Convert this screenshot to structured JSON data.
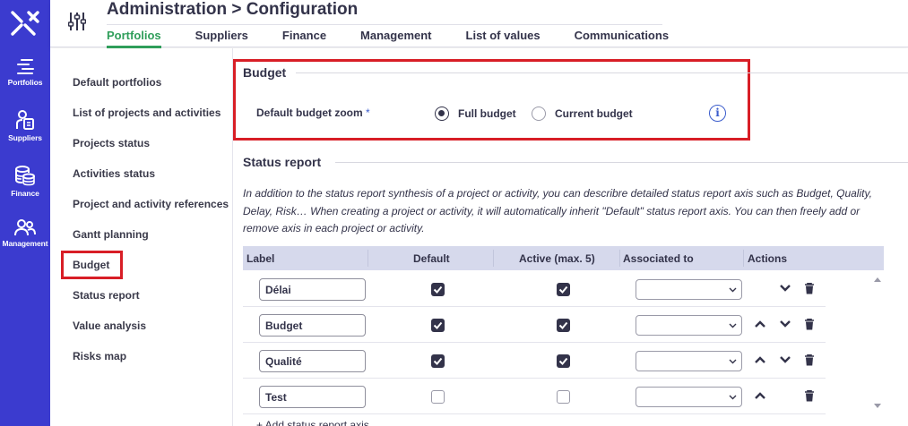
{
  "rail": {
    "items": [
      {
        "label": "Portfolios",
        "icon": "portfolios-icon"
      },
      {
        "label": "Suppliers",
        "icon": "suppliers-icon"
      },
      {
        "label": "Finance",
        "icon": "finance-icon"
      },
      {
        "label": "Management",
        "icon": "management-icon"
      }
    ],
    "logo_icon": "app-logo-icon",
    "bg_color": "#3b3bcf"
  },
  "header": {
    "title": "Administration > Configuration",
    "filter_icon": "sliders-icon",
    "tabs": [
      {
        "label": "Portfolios",
        "active": true
      },
      {
        "label": "Suppliers"
      },
      {
        "label": "Finance"
      },
      {
        "label": "Management"
      },
      {
        "label": "List of values"
      },
      {
        "label": "Communications"
      }
    ],
    "active_color": "#2f9e5a"
  },
  "subnav": {
    "items": [
      "Default portfolios",
      "List of projects and activities",
      "Projects status",
      "Activities status",
      "Project and activity references",
      "Gantt planning",
      "Budget",
      "Status report",
      "Value analysis",
      "Risks map"
    ],
    "selected": "Budget"
  },
  "budget": {
    "title": "Budget",
    "field_label": "Default budget zoom",
    "required_mark": "*",
    "options": [
      {
        "label": "Full budget",
        "selected": true
      },
      {
        "label": "Current budget",
        "selected": false
      }
    ],
    "info_icon": "info-icon",
    "info_glyph": "i"
  },
  "status_report": {
    "title": "Status report",
    "description": "In addition to the status report synthesis of a project or activity, you can describre detailed status report axis such as Budget, Quality, Delay, Risk… When creating a project or activity, it will automatically inherit \"Default\" status report axis. You can then freely add or remove axis in each project or activity.",
    "columns": [
      "Label",
      "Default",
      "Active (max. 5)",
      "Associated to",
      "Actions"
    ],
    "rows": [
      {
        "label": "Délai",
        "default": true,
        "active": true,
        "associated": "",
        "up": false,
        "down": true
      },
      {
        "label": "Budget",
        "default": true,
        "active": true,
        "associated": "",
        "up": true,
        "down": true
      },
      {
        "label": "Qualité",
        "default": true,
        "active": true,
        "associated": "",
        "up": true,
        "down": true
      },
      {
        "label": "Test",
        "default": false,
        "active": false,
        "associated": "",
        "up": true,
        "down": false
      }
    ],
    "add_label": "+ Add status report axis"
  },
  "highlight_color": "#d81e26"
}
